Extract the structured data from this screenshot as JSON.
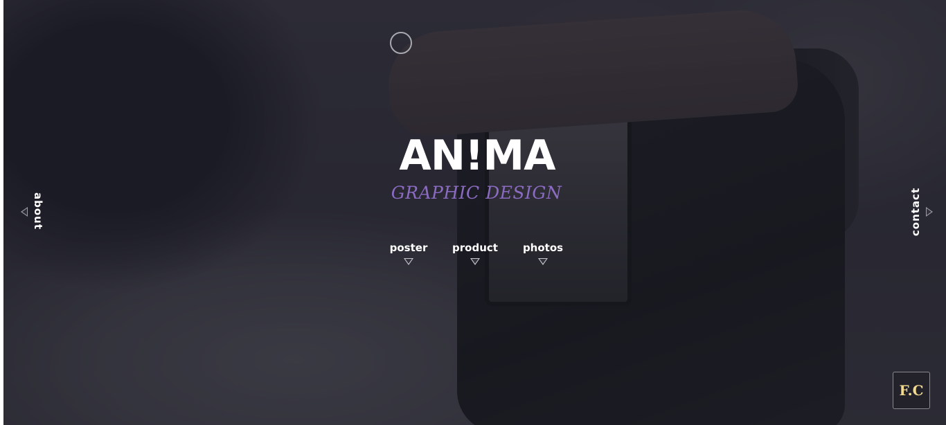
{
  "hero": {
    "title": "AN!MA",
    "subtitle": "GRAPHIC DESIGN",
    "accent_color": "#8b6cc2"
  },
  "nav": {
    "items": [
      {
        "label": "poster",
        "icon": "triangle-down-icon"
      },
      {
        "label": "product",
        "icon": "triangle-down-icon"
      },
      {
        "label": "photos",
        "icon": "triangle-down-icon"
      }
    ]
  },
  "side": {
    "left_label": "about",
    "left_icon": "triangle-left-icon",
    "right_label": "contact",
    "right_icon": "triangle-right-icon"
  },
  "logo": {
    "text": "F.C",
    "color": "#f3d98e"
  },
  "loader": {
    "icon": "circle-loader-icon"
  }
}
